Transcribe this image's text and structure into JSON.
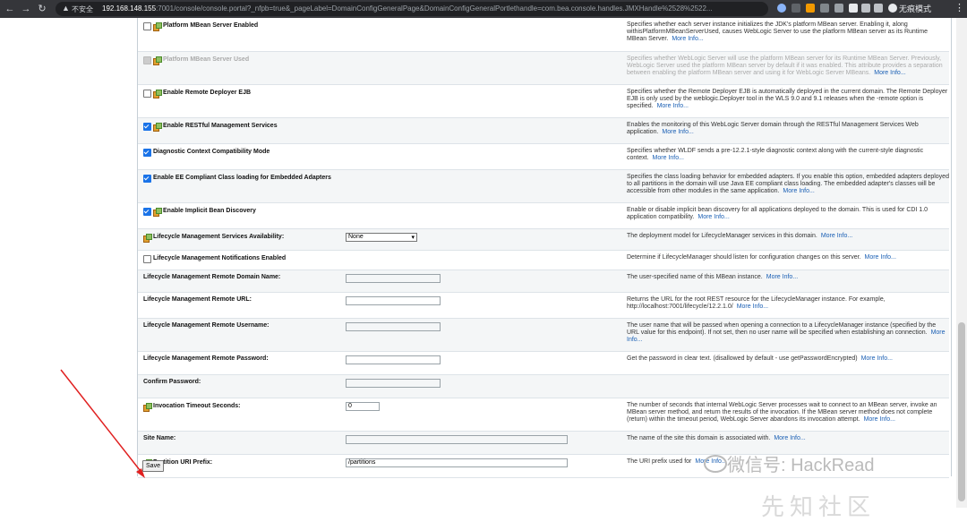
{
  "browser": {
    "insecure_label": "不安全",
    "url_host": "192.168.148.155",
    "url_rest": ":7001/console/console.portal?_nfpb=true&_pageLabel=DomainConfigGeneralPage&DomainConfigGeneralPortlethandle=com.bea.console.handles.JMXHandle%2528%2522...",
    "incognito_label": "无痕模式"
  },
  "rows": [
    {
      "label": "Platform MBean Server Enabled",
      "checkbox": "unchecked",
      "icon": "config-icon",
      "desc": "Specifies whether each server instance initializes the JDK's platform MBean server. Enabling it, along withisPlatformMBeanServerUsed, causes WebLogic Server to use the platform MBean server as its Runtime MBean Server.",
      "more": "More Info..."
    },
    {
      "label": "Platform MBean Server Used",
      "checkbox": "disabled",
      "icon": "config-icon",
      "desc": "Specifies whether WebLogic Server will use the platform MBean server for its Runtime MBean Server. Previously, WebLogic Server used the platform MBean server by default if it was enabled. This attribute provides a separation between enabling the platform MBean server and using it for WebLogic Server MBeans.",
      "more": "More Info..."
    },
    {
      "label": "Enable Remote Deployer EJB",
      "checkbox": "unchecked",
      "icon": "config-icon",
      "desc": "Specifies whether the Remote Deployer EJB is automatically deployed in the current domain. The Remote Deployer EJB is only used by the weblogic.Deployer tool in the WLS 9.0 and 9.1 releases when the -remote option is specified.",
      "more": "More Info..."
    },
    {
      "label": "Enable RESTful Management Services",
      "checkbox": "checked",
      "icon": "config-icon",
      "desc": "Enables the monitoring of this WebLogic Server domain through the RESTful Management Services Web application.",
      "more": "More Info..."
    },
    {
      "label": "Diagnostic Context Compatibility Mode",
      "checkbox": "checked",
      "icon": "",
      "desc": "Specifies whether WLDF sends a pre-12.2.1-style diagnostic context along with the current-style diagnostic context.",
      "more": "More Info..."
    },
    {
      "label": "Enable EE Compliant Class loading for Embedded Adapters",
      "checkbox": "checked",
      "icon": "",
      "desc": "Specifies the class loading behavior for embedded adapters. If you enable this option, embedded adapters deployed to all partitions in the domain will use Java EE compliant class loading. The embedded adapter's classes will be accessible from other modules in the same application.",
      "more": "More Info..."
    },
    {
      "label": "Enable Implicit Bean Discovery",
      "checkbox": "checked",
      "icon": "config-icon",
      "desc": "Enable or disable implicit bean discovery for all applications deployed to the domain. This is used for CDI 1.0 application compatibility.",
      "more": "More Info..."
    },
    {
      "label": "Lifecycle Management Services Availability:",
      "checkbox": "",
      "icon": "config-icon",
      "select": "None",
      "desc": "The deployment model for LifecycleManager services in this domain.",
      "more": "More Info..."
    },
    {
      "label": "Lifecycle Management Notifications Enabled",
      "checkbox": "unchecked",
      "icon": "",
      "desc": "Determine if LifecycleManager should listen for configuration changes on this server.",
      "more": "More Info..."
    },
    {
      "label": "Lifecycle Management Remote Domain Name:",
      "checkbox": "",
      "icon": "",
      "input": "",
      "desc": "The user-specified name of this MBean instance.",
      "more": "More Info..."
    },
    {
      "label": "Lifecycle Management Remote URL:",
      "checkbox": "",
      "icon": "",
      "input": "",
      "desc": "Returns the URL for the root REST resource for the LifecycleManager instance. For example, http://localhost:7001/lifecycle/12.2.1.0/",
      "more": "More Info..."
    },
    {
      "label": "Lifecycle Management Remote Username:",
      "checkbox": "",
      "icon": "",
      "input": "",
      "desc": "The user name that will be passed when opening a connection to a LifecycleManager instance (specified by the URL value for this endpoint). If not set, then no user name will be specified when establishing an connection.",
      "more": "More Info..."
    },
    {
      "label": "Lifecycle Management Remote Password:",
      "checkbox": "",
      "icon": "",
      "input": "",
      "desc": "Get the password in clear text. (disallowed by default - use getPasswordEncrypted)",
      "more": "More Info..."
    },
    {
      "label": "Confirm Password:",
      "checkbox": "",
      "icon": "",
      "input": "",
      "desc": "",
      "more": ""
    },
    {
      "label": "Invocation Timeout Seconds:",
      "checkbox": "",
      "icon": "config-icon",
      "input": "0",
      "input_size": "short",
      "desc": "The number of seconds that internal WebLogic Server processes wait to connect to an MBean server, invoke an MBean server method, and return the results of the invocation. If the MBean server method does not complete (return) within the timeout period, WebLogic Server abandons its invocation attempt.",
      "more": "More Info..."
    },
    {
      "label": "Site Name:",
      "checkbox": "",
      "icon": "",
      "input": "",
      "input_size": "wide",
      "desc": "The name of the site this domain is associated with.",
      "more": "More Info..."
    },
    {
      "label": "Partition URI Prefix:",
      "checkbox": "",
      "icon": "config-icon",
      "input": "/partitions",
      "input_size": "wide",
      "desc": "The URI prefix used for",
      "more": "More Info..."
    }
  ],
  "save_label": "Save",
  "watermark": "微信号: HackRead",
  "watermark2": "先知社区"
}
